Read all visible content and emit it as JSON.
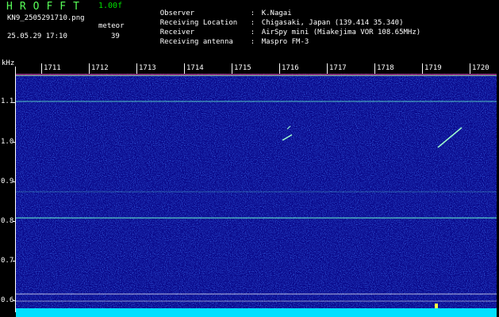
{
  "header": {
    "app_title": "HROFFT",
    "version": "1.00f",
    "filename": "KN9_2505291710.png",
    "mode": "meteor",
    "datetime": "25.05.29 17:10",
    "count": "39"
  },
  "info": [
    {
      "label": "Observer",
      "value": "K.Nagai"
    },
    {
      "label": "Receiving Location",
      "value": "Chigasaki, Japan (139.414 35.340)"
    },
    {
      "label": "Receiver",
      "value": "AirSpy mini (Miakejima VOR 108.65MHz)"
    },
    {
      "label": "Receiving antenna",
      "value": "Maspro FM-3"
    }
  ],
  "axis": {
    "unit": "kHz",
    "y_ticks": [
      "1.1",
      "1.0",
      "0.9",
      "0.8",
      "0.7",
      "0.6"
    ],
    "time_labels": [
      "1711",
      "1712",
      "1713",
      "1714",
      "1715",
      "1716",
      "1717",
      "1718",
      "1719",
      "1720"
    ]
  },
  "colors": {
    "background": "#000000",
    "noise_dark": "#0a0a8c",
    "noise_light": "#3b6cff",
    "carrier": "#5fe0c8",
    "echo": "#9fffd0",
    "baseline": "#00e0ff",
    "title": "#58ff58"
  }
}
